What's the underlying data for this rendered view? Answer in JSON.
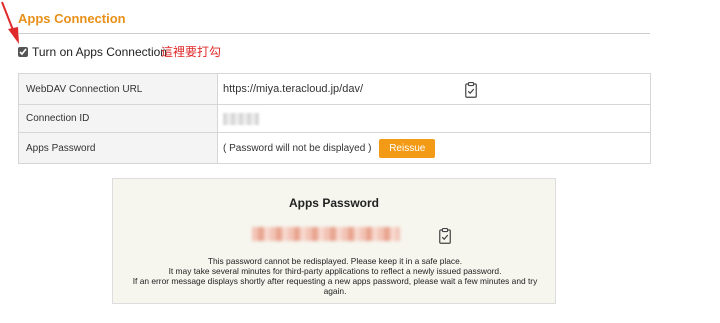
{
  "section": {
    "title": "Apps Connection"
  },
  "toggle": {
    "label": "Turn on Apps Connection",
    "checked": true
  },
  "annotation": {
    "text": "這裡要打勾"
  },
  "table": {
    "rows": [
      {
        "label": "WebDAV Connection URL",
        "value": "https://miya.teracloud.jp/dav/"
      },
      {
        "label": "Connection ID"
      },
      {
        "label": "Apps Password",
        "value": "( Password will not be displayed )"
      }
    ],
    "reissue_label": "Reissue"
  },
  "panel": {
    "title": "Apps Password",
    "message": [
      "This password cannot be redisplayed. Please keep it in a safe place.",
      "It may take several minutes for third-party applications to reflect a newly issued password.",
      "If an error message displays shortly after requesting a new apps password, please wait a few minutes and try again."
    ]
  },
  "colors": {
    "accent": "#f39a16",
    "title": "#e8901a",
    "annotation": "#e02a2a"
  }
}
